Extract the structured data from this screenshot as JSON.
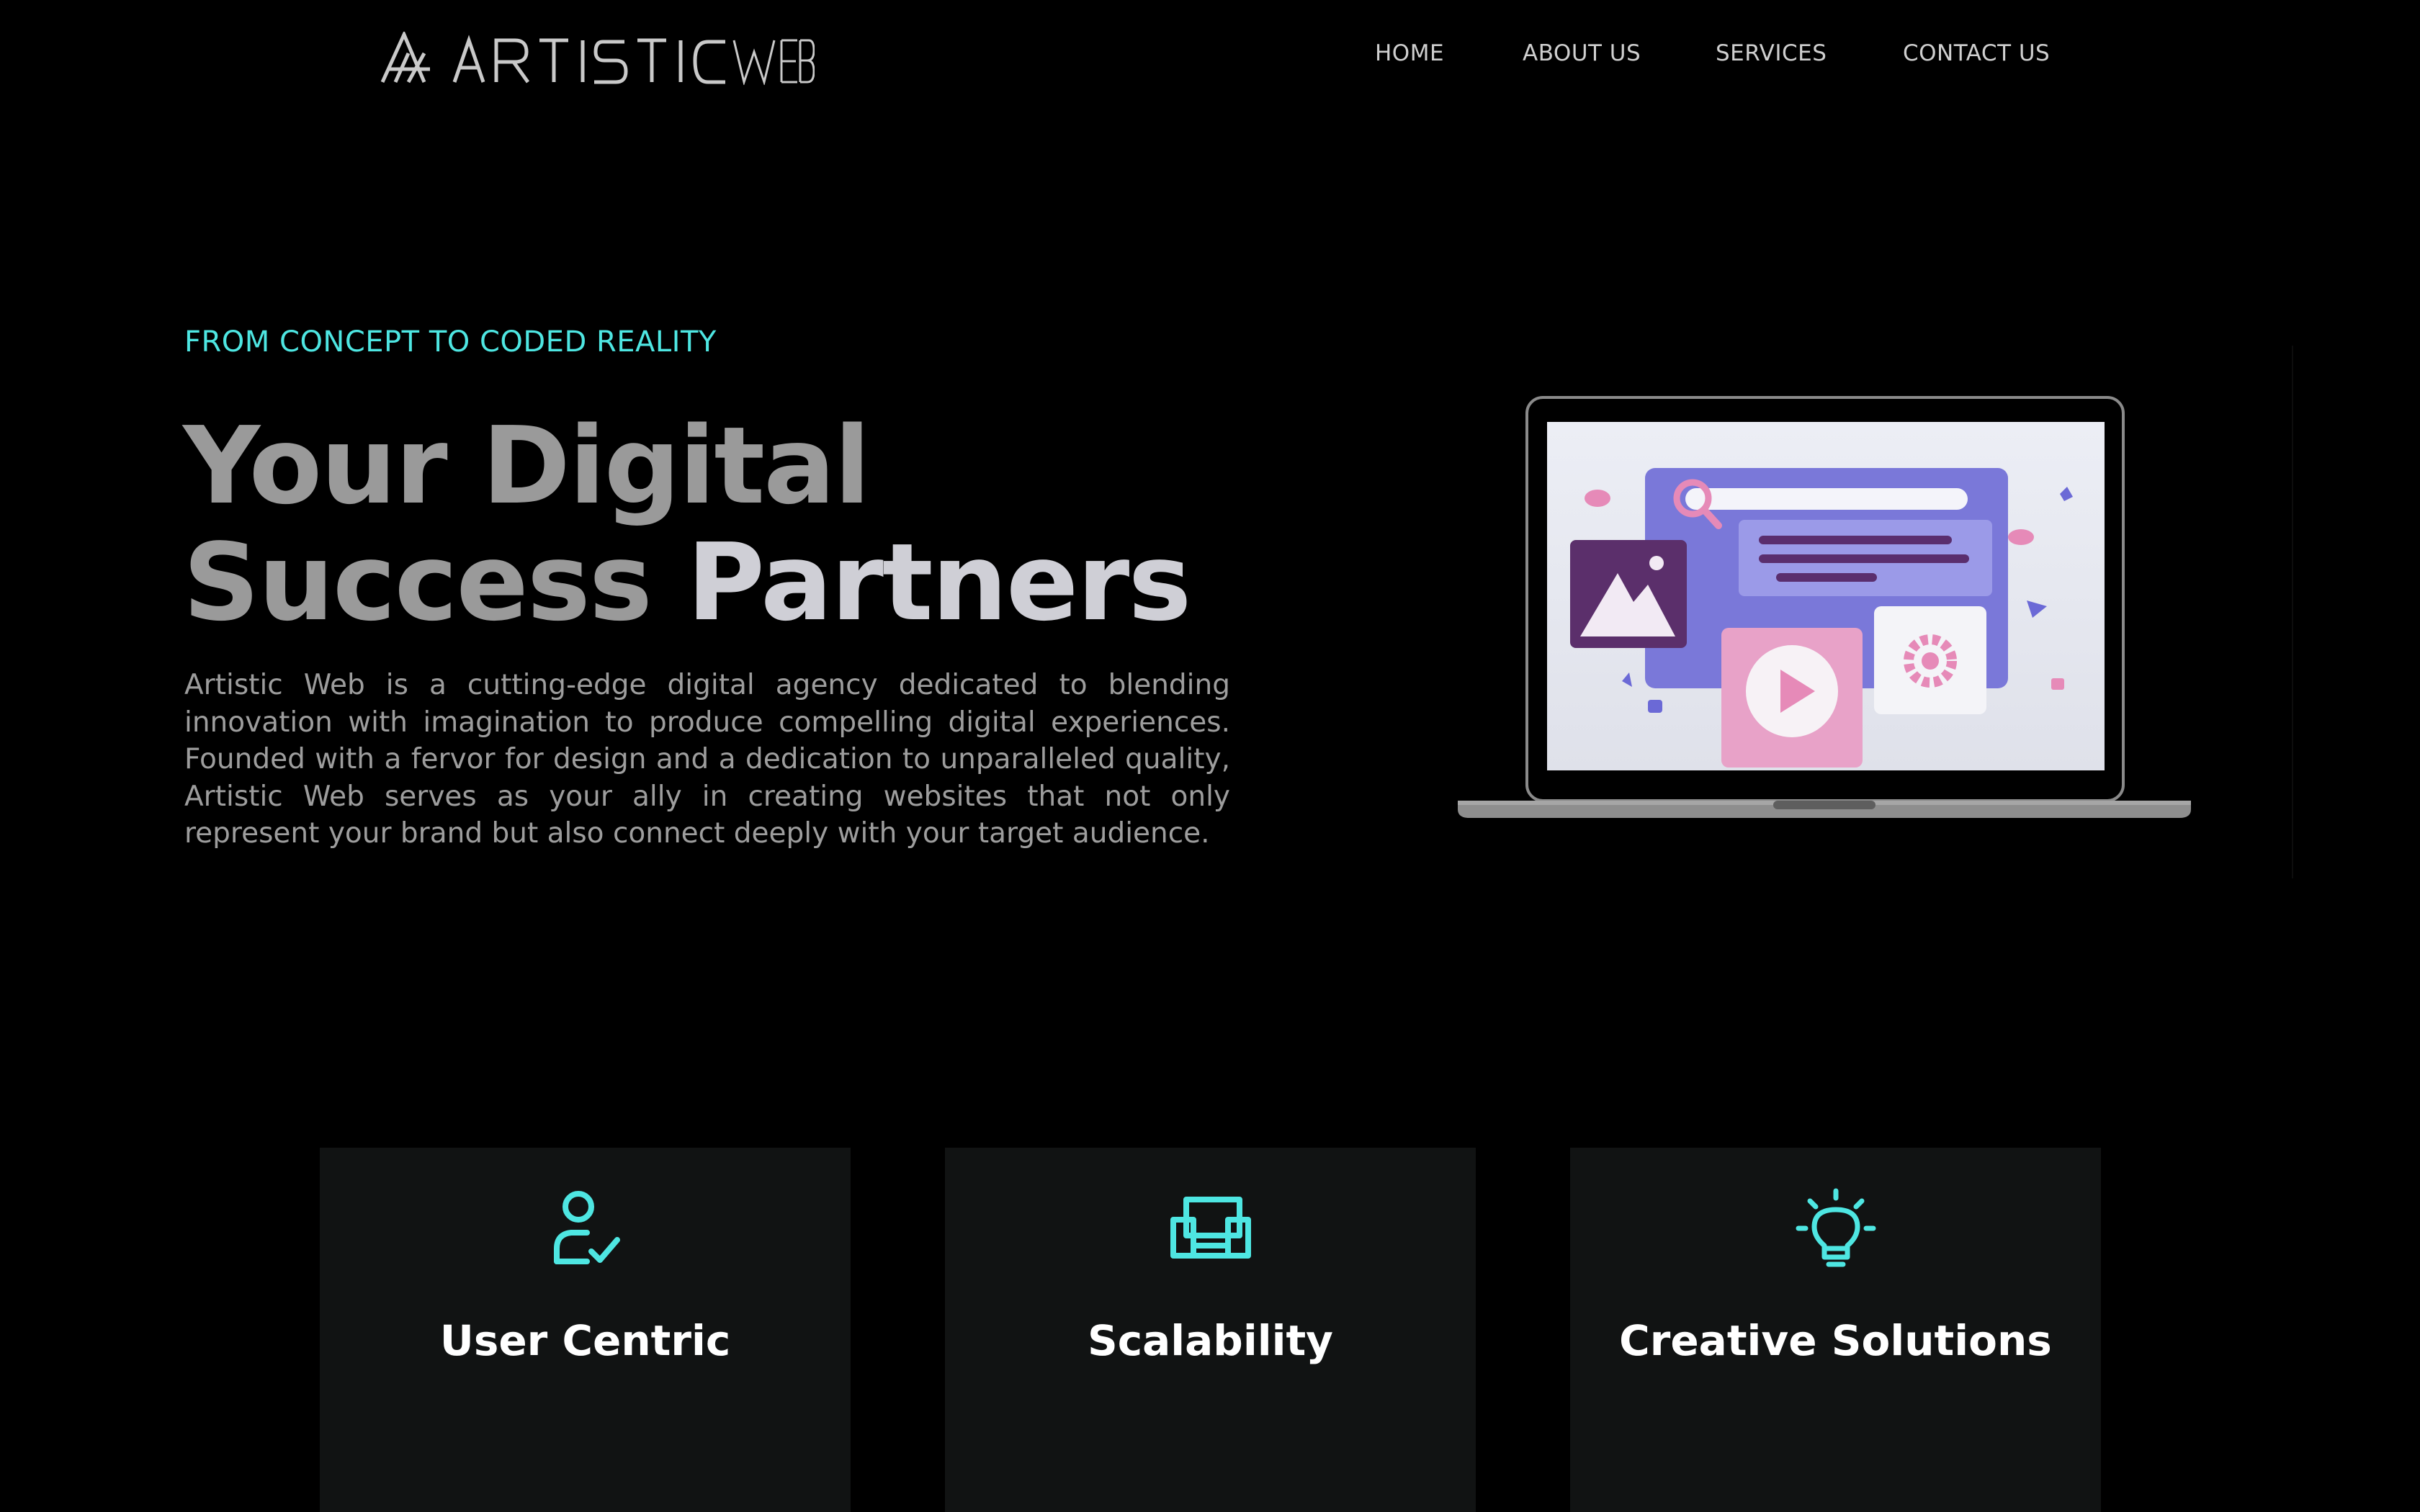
{
  "brand": {
    "logo_text": "ARTISTIC WEB"
  },
  "nav": {
    "items": [
      {
        "label": "HOME"
      },
      {
        "label": "ABOUT US"
      },
      {
        "label": "SERVICES"
      },
      {
        "label": "CONTACT US"
      }
    ]
  },
  "hero": {
    "eyebrow": "FROM CONCEPT TO CODED REALITY",
    "headline_line1": "Your Digital",
    "headline_line2_a": "Success ",
    "headline_line2_b": "Partners",
    "intro": "Artistic Web is a cutting-edge digital agency dedicated to blending innovation with imagination to produce compelling digital experiences. Founded with a fervor for design and a dedication to unparalleled quality, Artistic Web serves as your ally in creating websites that not only represent your brand but also connect deeply with your target audience."
  },
  "features": [
    {
      "icon": "user-check-icon",
      "title": "User Centric"
    },
    {
      "icon": "devices-icon",
      "title": "Scalability"
    },
    {
      "icon": "lightbulb-icon",
      "title": "Creative Solutions"
    }
  ],
  "colors": {
    "background": "#000000",
    "accent": "#4EE6E2",
    "card_bg": "#111313",
    "headline_gray": "#9A9A9A",
    "body_gray": "#9D9D9D"
  }
}
